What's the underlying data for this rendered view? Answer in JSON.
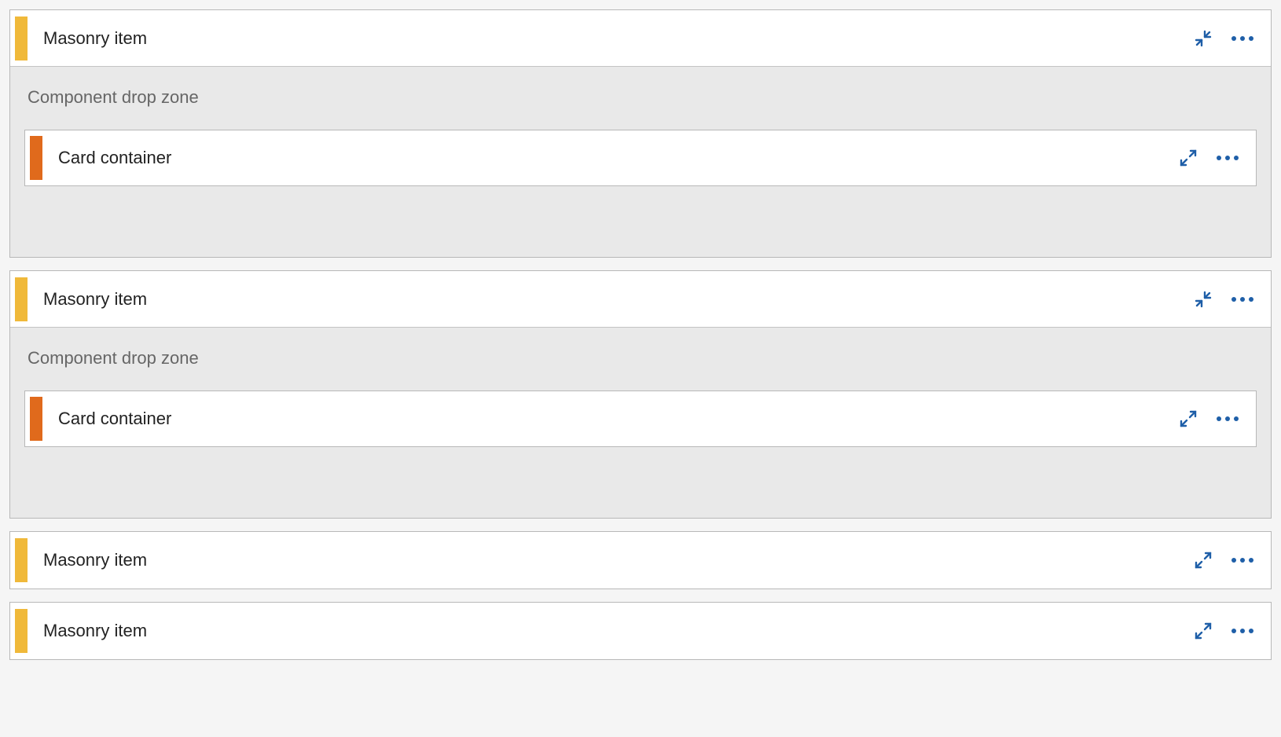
{
  "labels": {
    "dropzone": "Component drop zone"
  },
  "colors": {
    "masonry_tab": "#f0b93a",
    "card_tab": "#e06a1c",
    "icon": "#1f5fa8"
  },
  "items": [
    {
      "title": "Masonry item",
      "expanded": true,
      "child": {
        "title": "Card container",
        "expanded": false
      }
    },
    {
      "title": "Masonry item",
      "expanded": true,
      "child": {
        "title": "Card container",
        "expanded": false
      }
    },
    {
      "title": "Masonry item",
      "expanded": false
    },
    {
      "title": "Masonry item",
      "expanded": false
    }
  ]
}
